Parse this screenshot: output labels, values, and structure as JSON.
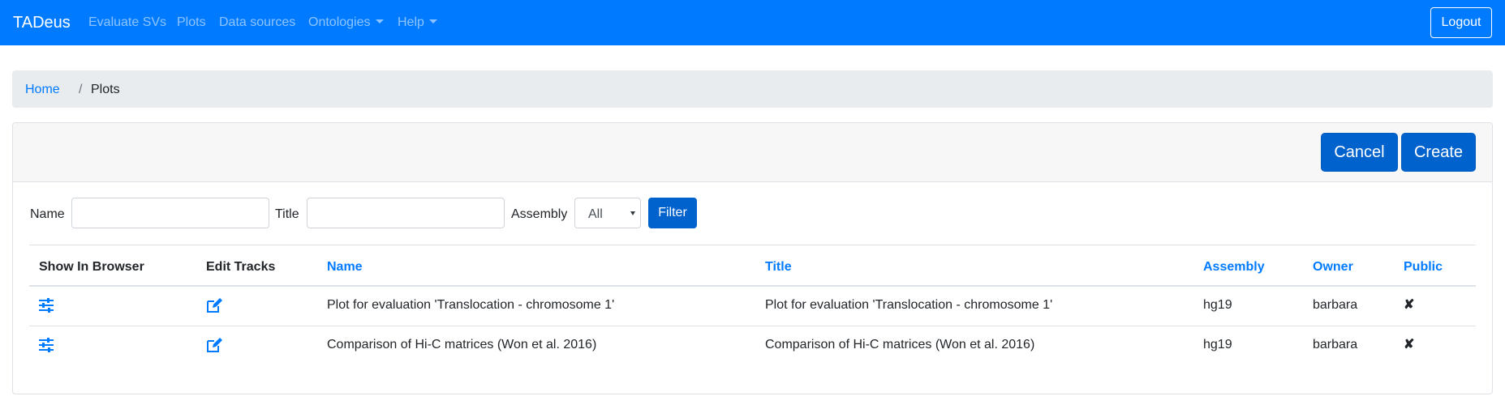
{
  "navbar": {
    "brand": "TADeus",
    "links": [
      {
        "label": "Evaluate SVs"
      },
      {
        "label": "Plots"
      },
      {
        "label": "Data sources"
      },
      {
        "label": "Ontologies"
      },
      {
        "label": "Help"
      }
    ],
    "logout_label": "Logout",
    "colors": {
      "background": "#007bff",
      "link": "rgba(255,255,255,0.55)"
    }
  },
  "breadcrumb": {
    "home": "Home",
    "separator": "/",
    "current": "Plots"
  },
  "card": {
    "cancel_label": "Cancel",
    "create_label": "Create"
  },
  "filter": {
    "name_label": "Name",
    "name_value": "",
    "title_label": "Title",
    "title_value": "",
    "assembly_label": "Assembly",
    "assembly_selected": "All",
    "filter_button": "Filter"
  },
  "table": {
    "headers": {
      "show_in_browser": "Show In Browser",
      "edit_tracks": "Edit Tracks",
      "name": "Name",
      "title": "Title",
      "assembly": "Assembly",
      "owner": "Owner",
      "public": "Public"
    },
    "rows": [
      {
        "show_icon": "sliders-icon",
        "edit_icon": "edit-icon",
        "name": "Plot for evaluation 'Translocation - chromosome 1'",
        "title": "Plot for evaluation 'Translocation - chromosome 1'",
        "assembly": "hg19",
        "owner": "barbara",
        "public": "✘"
      },
      {
        "show_icon": "sliders-icon",
        "edit_icon": "edit-icon",
        "name": "Comparison of Hi-C matrices (Won et al. 2016)",
        "title": "Comparison of Hi-C matrices (Won et al. 2016)",
        "assembly": "hg19",
        "owner": "barbara",
        "public": "✘"
      }
    ]
  }
}
